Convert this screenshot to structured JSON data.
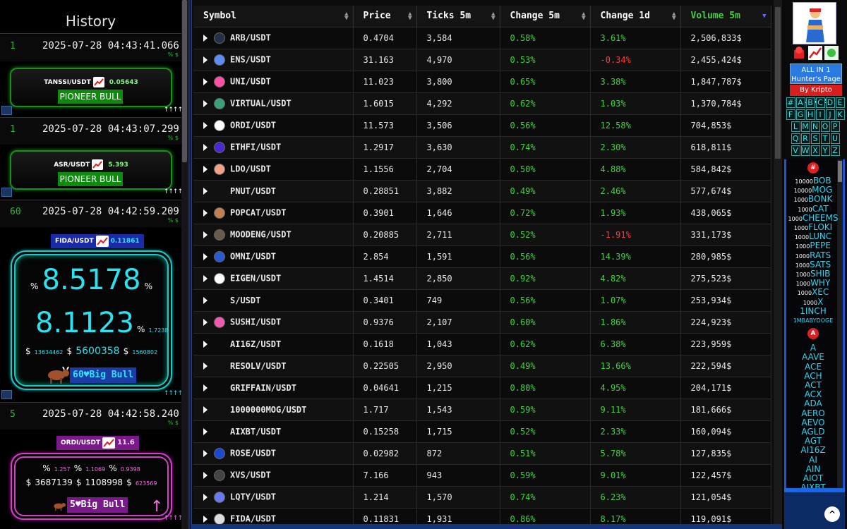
{
  "history": {
    "title": "History",
    "entries": [
      {
        "num": "1",
        "date": "2025-07-28 04:43:41.066",
        "mini": "% $",
        "symbol": "TANSSI/USDT",
        "price": "0.05643",
        "label": "PIONEER BULL",
        "arrows": "↑↑↑↑"
      },
      {
        "num": "1",
        "date": "2025-07-28 04:43:07.299",
        "mini": "% $",
        "symbol": "ASR/USDT",
        "price": "5.393",
        "label": "PIONEER BULL",
        "arrows": "↑↑↑↑"
      },
      {
        "num": "60",
        "date": "2025-07-28 04:42:59.209",
        "mini": "% $",
        "symbol": "FIDA/USDT",
        "price": "0.11861",
        "pct1": "8.5178",
        "pct2": "8.1123",
        "pct2_small": "1.7238",
        "usd_a": "13634462",
        "usd_b": "5600358",
        "usd_c": "1560802",
        "badge": "60♥Big Bull",
        "arrows": "↑↑↑↑"
      },
      {
        "num": "5",
        "date": "2025-07-28 04:42:58.240",
        "mini": "% $",
        "symbol": "ORDI/USDT",
        "price": "11.6",
        "pct_a": "1.257",
        "pct_b": "1.1069",
        "pct_c": "0.9398",
        "usd_a": "3687139",
        "usd_b": "1108998",
        "usd_c": "623569",
        "badge": "5♥Big Bull",
        "arrows": "↑↑↑↑"
      }
    ],
    "pct_sign": "%",
    "usd_sign": "$"
  },
  "table": {
    "headers": [
      "Symbol",
      "Price",
      "Ticks 5m",
      "Change 5m",
      "Change 1d",
      "Volume 5m"
    ],
    "rows": [
      {
        "symbol": "ARB/USDT",
        "price": "0.4704",
        "ticks": "3,584",
        "c5": "0.58%",
        "c1d": "3.61%",
        "vol": "2,506,833$",
        "icon": "arb",
        "neg": false
      },
      {
        "symbol": "ENS/USDT",
        "price": "31.163",
        "ticks": "4,970",
        "c5": "0.53%",
        "c1d": "-0.34%",
        "vol": "2,455,424$",
        "icon": "ens",
        "neg": true
      },
      {
        "symbol": "UNI/USDT",
        "price": "11.023",
        "ticks": "3,800",
        "c5": "0.65%",
        "c1d": "3.38%",
        "vol": "1,847,787$",
        "icon": "uni",
        "neg": false
      },
      {
        "symbol": "VIRTUAL/USDT",
        "price": "1.6015",
        "ticks": "4,292",
        "c5": "0.62%",
        "c1d": "1.03%",
        "vol": "1,370,784$",
        "icon": "virtual",
        "neg": false
      },
      {
        "symbol": "ORDI/USDT",
        "price": "11.573",
        "ticks": "3,506",
        "c5": "0.56%",
        "c1d": "12.58%",
        "vol": "704,853$",
        "icon": "ordi",
        "neg": false
      },
      {
        "symbol": "ETHFI/USDT",
        "price": "1.2917",
        "ticks": "3,630",
        "c5": "0.74%",
        "c1d": "2.30%",
        "vol": "618,811$",
        "icon": "ethfi",
        "neg": false
      },
      {
        "symbol": "LDO/USDT",
        "price": "1.1556",
        "ticks": "2,704",
        "c5": "0.50%",
        "c1d": "4.88%",
        "vol": "584,842$",
        "icon": "ldo",
        "neg": false
      },
      {
        "symbol": "PNUT/USDT",
        "price": "0.28851",
        "ticks": "3,882",
        "c5": "0.49%",
        "c1d": "2.46%",
        "vol": "577,674$",
        "icon": "",
        "neg": false
      },
      {
        "symbol": "POPCAT/USDT",
        "price": "0.3901",
        "ticks": "1,646",
        "c5": "0.72%",
        "c1d": "1.93%",
        "vol": "438,065$",
        "icon": "popcat",
        "neg": false
      },
      {
        "symbol": "MOODENG/USDT",
        "price": "0.20885",
        "ticks": "2,711",
        "c5": "0.52%",
        "c1d": "-1.91%",
        "vol": "331,173$",
        "icon": "moodeng",
        "neg": true
      },
      {
        "symbol": "OMNI/USDT",
        "price": "2.854",
        "ticks": "1,591",
        "c5": "0.56%",
        "c1d": "14.39%",
        "vol": "280,985$",
        "icon": "omni",
        "neg": false
      },
      {
        "symbol": "EIGEN/USDT",
        "price": "1.4514",
        "ticks": "2,850",
        "c5": "0.92%",
        "c1d": "4.82%",
        "vol": "275,523$",
        "icon": "eigen",
        "neg": false
      },
      {
        "symbol": "S/USDT",
        "price": "0.3401",
        "ticks": "749",
        "c5": "0.56%",
        "c1d": "1.07%",
        "vol": "253,934$",
        "icon": "",
        "neg": false
      },
      {
        "symbol": "SUSHI/USDT",
        "price": "0.9376",
        "ticks": "2,107",
        "c5": "0.60%",
        "c1d": "1.86%",
        "vol": "224,923$",
        "icon": "sushi",
        "neg": false
      },
      {
        "symbol": "AI16Z/USDT",
        "price": "0.1618",
        "ticks": "1,043",
        "c5": "0.62%",
        "c1d": "6.38%",
        "vol": "223,959$",
        "icon": "",
        "neg": false
      },
      {
        "symbol": "RESOLV/USDT",
        "price": "0.22505",
        "ticks": "2,950",
        "c5": "0.49%",
        "c1d": "13.66%",
        "vol": "222,594$",
        "icon": "",
        "neg": false
      },
      {
        "symbol": "GRIFFAIN/USDT",
        "price": "0.04641",
        "ticks": "1,215",
        "c5": "0.80%",
        "c1d": "4.95%",
        "vol": "204,171$",
        "icon": "",
        "neg": false
      },
      {
        "symbol": "1000000MOG/USDT",
        "price": "1.717",
        "ticks": "1,543",
        "c5": "0.59%",
        "c1d": "9.11%",
        "vol": "181,666$",
        "icon": "",
        "neg": false
      },
      {
        "symbol": "AIXBT/USDT",
        "price": "0.15258",
        "ticks": "1,715",
        "c5": "0.52%",
        "c1d": "2.33%",
        "vol": "160,094$",
        "icon": "",
        "neg": false
      },
      {
        "symbol": "ROSE/USDT",
        "price": "0.02982",
        "ticks": "872",
        "c5": "0.51%",
        "c1d": "5.78%",
        "vol": "127,835$",
        "icon": "rose",
        "neg": false
      },
      {
        "symbol": "XVS/USDT",
        "price": "7.166",
        "ticks": "943",
        "c5": "0.59%",
        "c1d": "9.01%",
        "vol": "122,457$",
        "icon": "xvs",
        "neg": false
      },
      {
        "symbol": "LQTY/USDT",
        "price": "1.214",
        "ticks": "1,570",
        "c5": "0.74%",
        "c1d": "6.23%",
        "vol": "121,054$",
        "icon": "lqty",
        "neg": false
      },
      {
        "symbol": "FIDA/USDT",
        "price": "0.11831",
        "ticks": "1,931",
        "c5": "0.86%",
        "c1d": "8.17%",
        "vol": "119,091$",
        "icon": "fida",
        "neg": false
      }
    ]
  },
  "right": {
    "allin_line1": "ALL IN 1",
    "allin_line2": "Hunter's Page",
    "by": "By Kripto Analiz",
    "letters": [
      [
        "#",
        "A",
        "B",
        "C",
        "D",
        "E"
      ],
      [
        "F",
        "G",
        "H",
        "I",
        "J",
        "K"
      ],
      [
        "L",
        "M",
        "N",
        "O",
        "P"
      ],
      [
        "Q",
        "R",
        "S",
        "T",
        "U"
      ],
      [
        "V",
        "W",
        "X",
        "Y",
        "Z"
      ]
    ],
    "hash_badge": "#",
    "a_badge": "A",
    "num_coins": [
      {
        "pre": "10000",
        "name": "BOB"
      },
      {
        "pre": "10000",
        "name": "MOG"
      },
      {
        "pre": "1000",
        "name": "BONK"
      },
      {
        "pre": "1000",
        "name": "CAT"
      },
      {
        "pre": "1000",
        "name": "CHEEMS"
      },
      {
        "pre": "1000",
        "name": "FLOKI"
      },
      {
        "pre": "1000",
        "name": "LUNC"
      },
      {
        "pre": "1000",
        "name": "PEPE"
      },
      {
        "pre": "1000",
        "name": "RATS"
      },
      {
        "pre": "1000",
        "name": "SATS"
      },
      {
        "pre": "1000",
        "name": "SHIB"
      },
      {
        "pre": "1000",
        "name": "WHY"
      },
      {
        "pre": "1000",
        "name": "XEC"
      },
      {
        "pre": "1000",
        "name": "X"
      },
      {
        "pre": "",
        "name": "1INCH"
      },
      {
        "pre": "",
        "name": "1MBABYDOGE"
      }
    ],
    "a_coins": [
      "A",
      "AAVE",
      "ACE",
      "ACH",
      "ACT",
      "ACX",
      "ADA",
      "AERO",
      "AEVO",
      "AGLD",
      "AGT",
      "AI16Z",
      "AI",
      "AIN",
      "AIOT",
      "AIXBT"
    ],
    "up_button": "^"
  },
  "colors": {
    "positive": "#3fd43f",
    "negative": "#ff3a3a",
    "accent_cyan": "#2be3f0",
    "accent_pink": "#ff6fe8",
    "bull_green": "#0e8a0e"
  }
}
